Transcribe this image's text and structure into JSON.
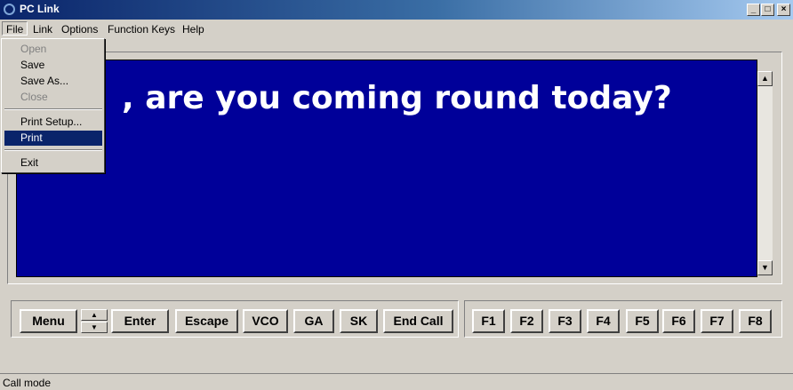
{
  "window": {
    "title": "PC Link",
    "min_glyph": "_",
    "max_glyph": "□",
    "close_glyph": "×"
  },
  "menubar": [
    "File",
    "Link",
    "Options",
    "Function Keys",
    "Help"
  ],
  "file_menu": {
    "items": [
      {
        "label": "Open",
        "disabled": true
      },
      {
        "label": "Save",
        "disabled": false
      },
      {
        "label": "Save As...",
        "disabled": false
      },
      {
        "label": "Close",
        "disabled": true
      },
      {
        "label": "Print Setup...",
        "disabled": false
      },
      {
        "label": "Print",
        "disabled": false,
        "selected": true
      },
      {
        "label": "Exit",
        "disabled": false
      }
    ]
  },
  "display": {
    "text": ", are you coming round today?"
  },
  "scroll": {
    "up_glyph": "▲",
    "down_glyph": "▼"
  },
  "controls": {
    "menu": "Menu",
    "spin_up": "▲",
    "spin_down": "▼",
    "enter": "Enter",
    "escape": "Escape",
    "vco": "VCO",
    "ga": "GA",
    "sk": "SK",
    "end_call": "End Call"
  },
  "fkeys": [
    "F1",
    "F2",
    "F3",
    "F4",
    "F5",
    "F6",
    "F7",
    "F8"
  ],
  "status": {
    "text": "Call mode"
  },
  "colors": {
    "display_bg": "#000099",
    "titlebar": "#0a246a",
    "face": "#d4d0c8",
    "highlight": "#0a246a"
  }
}
